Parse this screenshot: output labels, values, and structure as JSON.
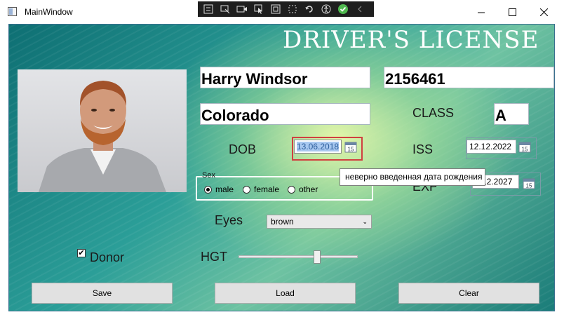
{
  "window": {
    "title": "MainWindow",
    "controls": {
      "minimize": "minimize",
      "maximize": "maximize",
      "close": "close"
    }
  },
  "license": {
    "heading": "DRIVER'S LICENSE",
    "name": "Harry Windsor",
    "number": "2156461",
    "state": "Colorado",
    "class_label": "CLASS",
    "class_value": "A",
    "dob_label": "DOB",
    "dob_value": "13.06.2018",
    "iss_label": "ISS",
    "iss_value": "12.12.2022",
    "exp_label": "EXP",
    "exp_value": "12.2027",
    "tooltip": "неверно введенная дата рождения"
  },
  "sex": {
    "title": "Sex",
    "options": [
      "male",
      "female",
      "other"
    ],
    "selected": "male"
  },
  "eyes": {
    "label": "Eyes",
    "value": "brown"
  },
  "donor": {
    "label": "Donor",
    "checked": true
  },
  "height": {
    "label": "HGT",
    "slider_fraction": 0.67
  },
  "buttons": {
    "save": "Save",
    "load": "Load",
    "clear": "Clear"
  },
  "colors": {
    "invalid_border": "#d04040",
    "selection": "#a8c8f0",
    "heading": "#ffffff"
  },
  "icons": [
    "app-icon",
    "calendar-icon",
    "minimize-icon",
    "maximize-icon",
    "close-icon",
    "checkmark-icon"
  ]
}
